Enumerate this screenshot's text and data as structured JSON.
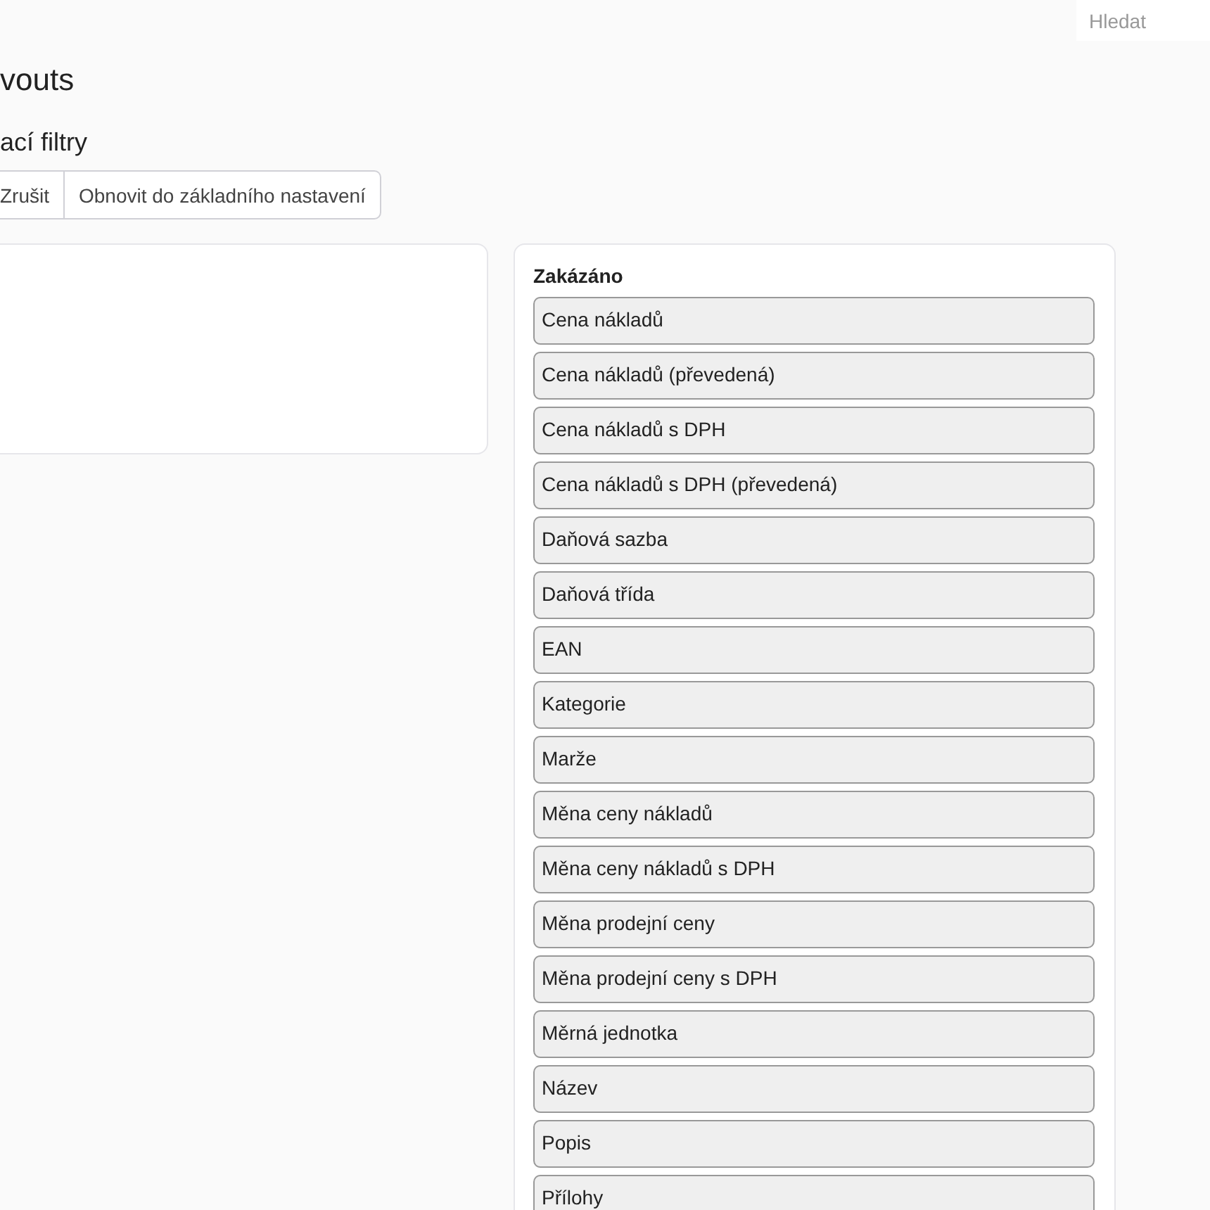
{
  "search": {
    "placeholder": "Hledat"
  },
  "page_title": "vouts",
  "section_title": "ací filtry",
  "buttons": [
    "Zrušit",
    "Obnovit do základního nastavení"
  ],
  "disabled_panel": {
    "title": "Zakázáno",
    "items": [
      "Cena nákladů",
      "Cena nákladů (převedená)",
      "Cena nákladů s DPH",
      "Cena nákladů s DPH (převedená)",
      "Daňová sazba",
      "Daňová třída",
      "EAN",
      "Kategorie",
      "Marže",
      "Měna ceny nákladů",
      "Měna ceny nákladů s DPH",
      "Měna prodejní ceny",
      "Měna prodejní ceny s DPH",
      "Měrná jednotka",
      "Název",
      "Popis",
      "Přílohy"
    ]
  }
}
